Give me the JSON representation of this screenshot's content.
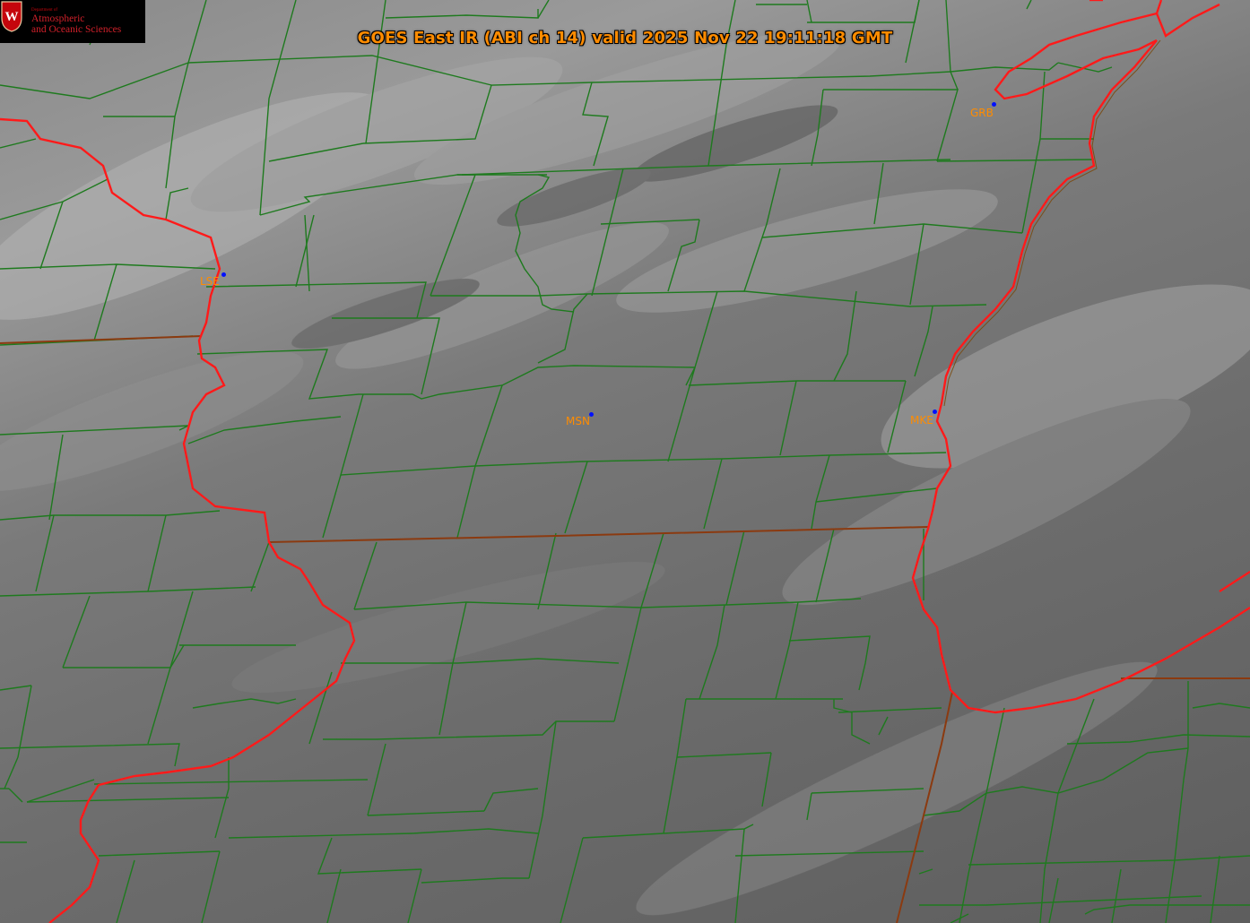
{
  "title": "GOES East IR (ABI ch 14) valid 2025 Nov 22 19:11:18 GMT",
  "logo": {
    "small_text": "Department of",
    "line1": "Atmospheric",
    "line2": "and Oceanic Sciences",
    "crest_letter": "W",
    "crest_icon": "uw-crest-icon"
  },
  "stations": [
    {
      "id": "LSE",
      "label": "LSE"
    },
    {
      "id": "MSN",
      "label": "MSN"
    },
    {
      "id": "MKE",
      "label": "MKE"
    },
    {
      "id": "GRB",
      "label": "GRB"
    }
  ],
  "colors": {
    "title": "#ff8c00",
    "station_label": "#ff8c00",
    "station_dot": "#0010ff",
    "county_lines": "#1e7a1e",
    "state_lines": "#8b3a10",
    "coastline": "#ff1a1a"
  }
}
